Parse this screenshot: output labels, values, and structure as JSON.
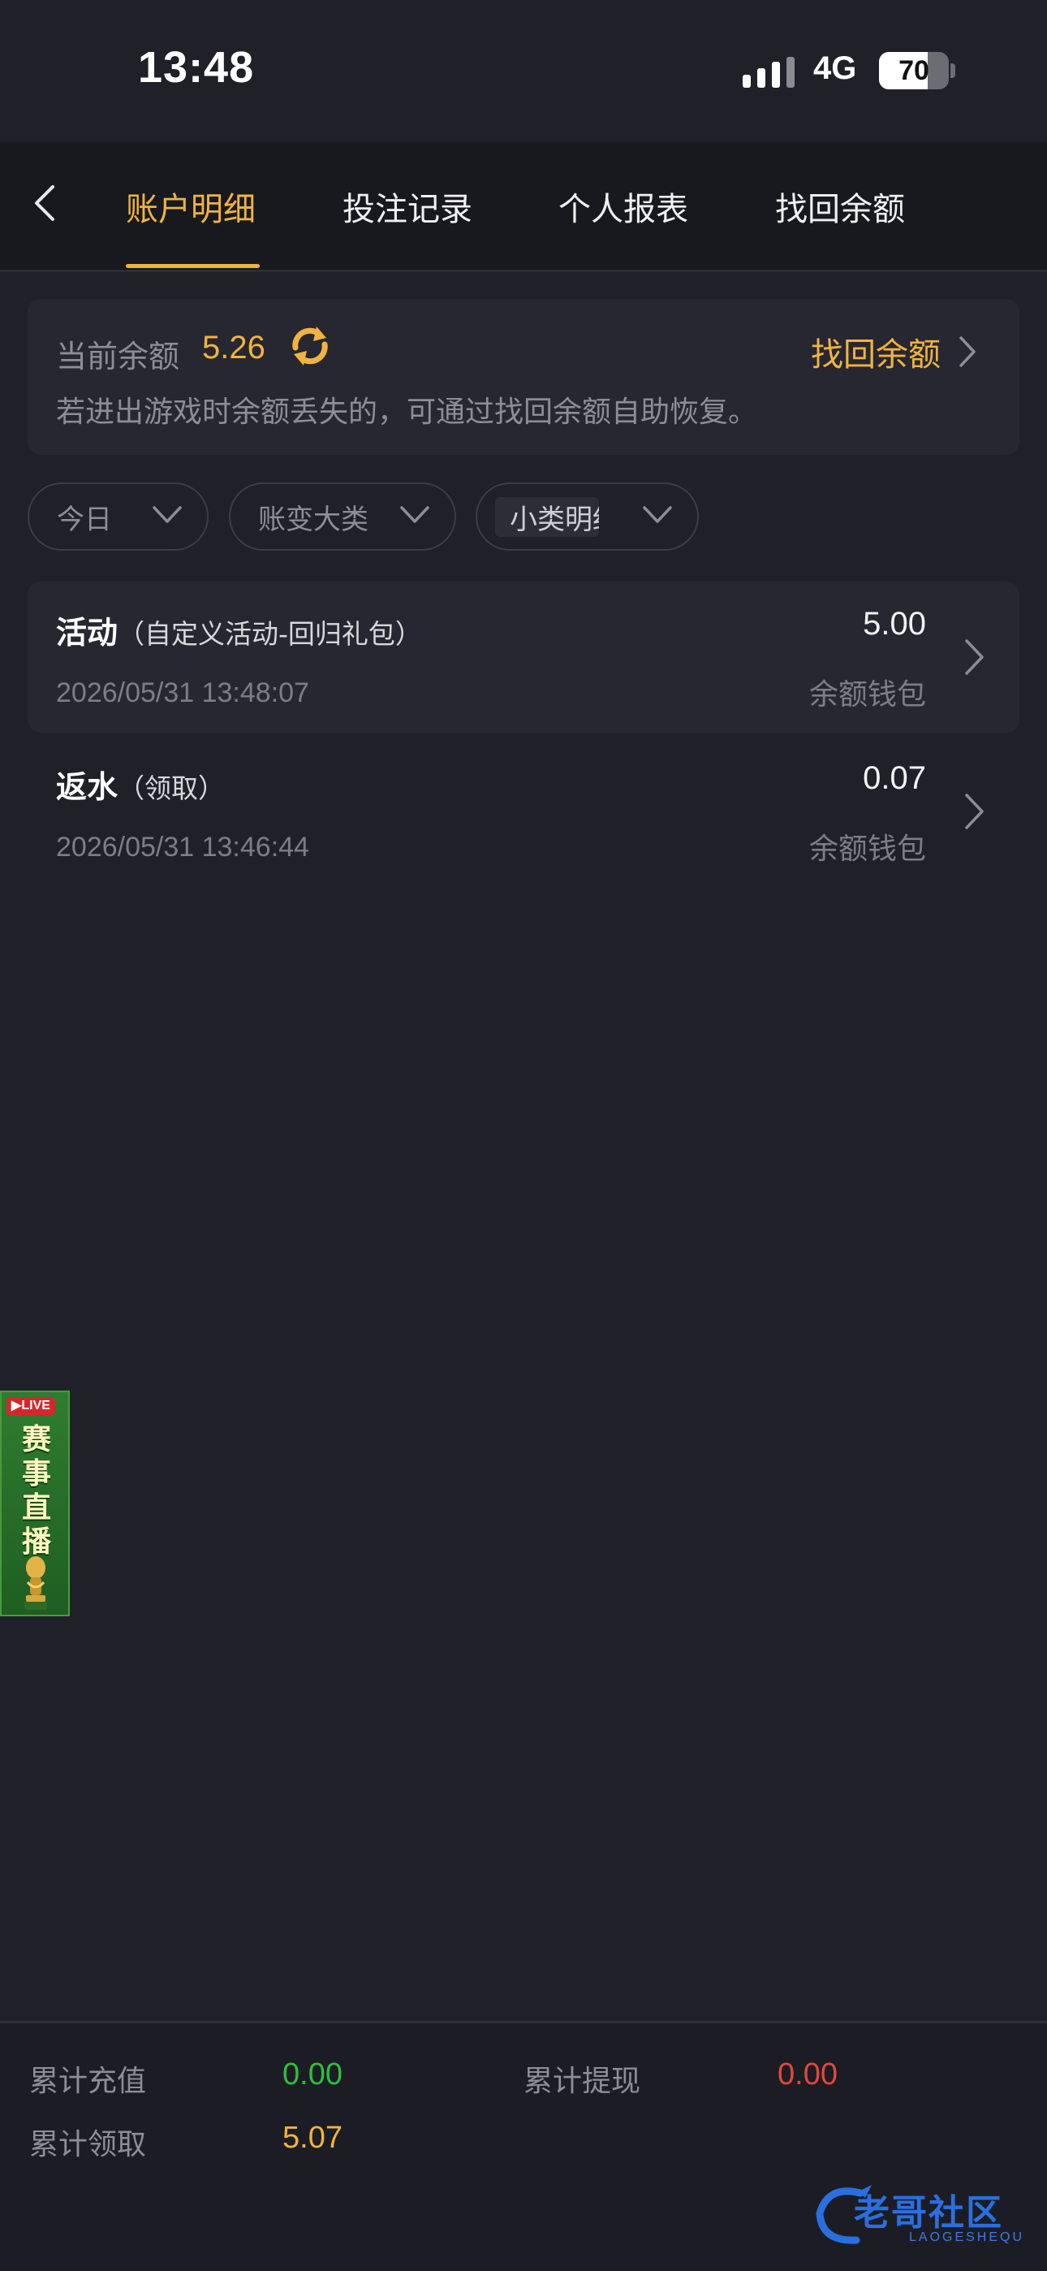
{
  "status_bar": {
    "time": "13:48",
    "network": "4G",
    "battery": "70",
    "battery_level": 0.7
  },
  "nav": {
    "tabs": [
      {
        "label": "账户明细",
        "active": true
      },
      {
        "label": "投注记录",
        "active": false
      },
      {
        "label": "个人报表",
        "active": false
      },
      {
        "label": "找回余额",
        "active": false
      }
    ]
  },
  "balance": {
    "label": "当前余额",
    "value": "5.26",
    "recover_link": "找回余额",
    "hint": "若进出游戏时余额丢失的，可通过找回余额自助恢复。"
  },
  "filters": [
    {
      "label": "今日"
    },
    {
      "label": "账变大类"
    },
    {
      "label": "小类明细"
    }
  ],
  "records": [
    {
      "title": "活动",
      "subtitle": "（自定义活动-回归礼包）",
      "time": "2026/05/31 13:48:07",
      "amount": "5.00",
      "wallet": "余额钱包"
    },
    {
      "title": "返水",
      "subtitle": "（领取）",
      "time": "2026/05/31 13:46:44",
      "amount": "0.07",
      "wallet": "余额钱包"
    }
  ],
  "live_widget": {
    "badge": "LIVE",
    "text": "赛事直播"
  },
  "totals": {
    "recharge_label": "累计充值",
    "recharge_value": "0.00",
    "withdraw_label": "累计提现",
    "withdraw_value": "0.00",
    "claim_label": "累计领取",
    "claim_value": "5.07"
  },
  "watermark": {
    "text": "老哥社区",
    "sub": "LAOGESHEQU"
  },
  "colors": {
    "accent": "#f0b341",
    "positive": "#2fbf3a",
    "negative": "#e0483e",
    "background": "#1f2028"
  }
}
